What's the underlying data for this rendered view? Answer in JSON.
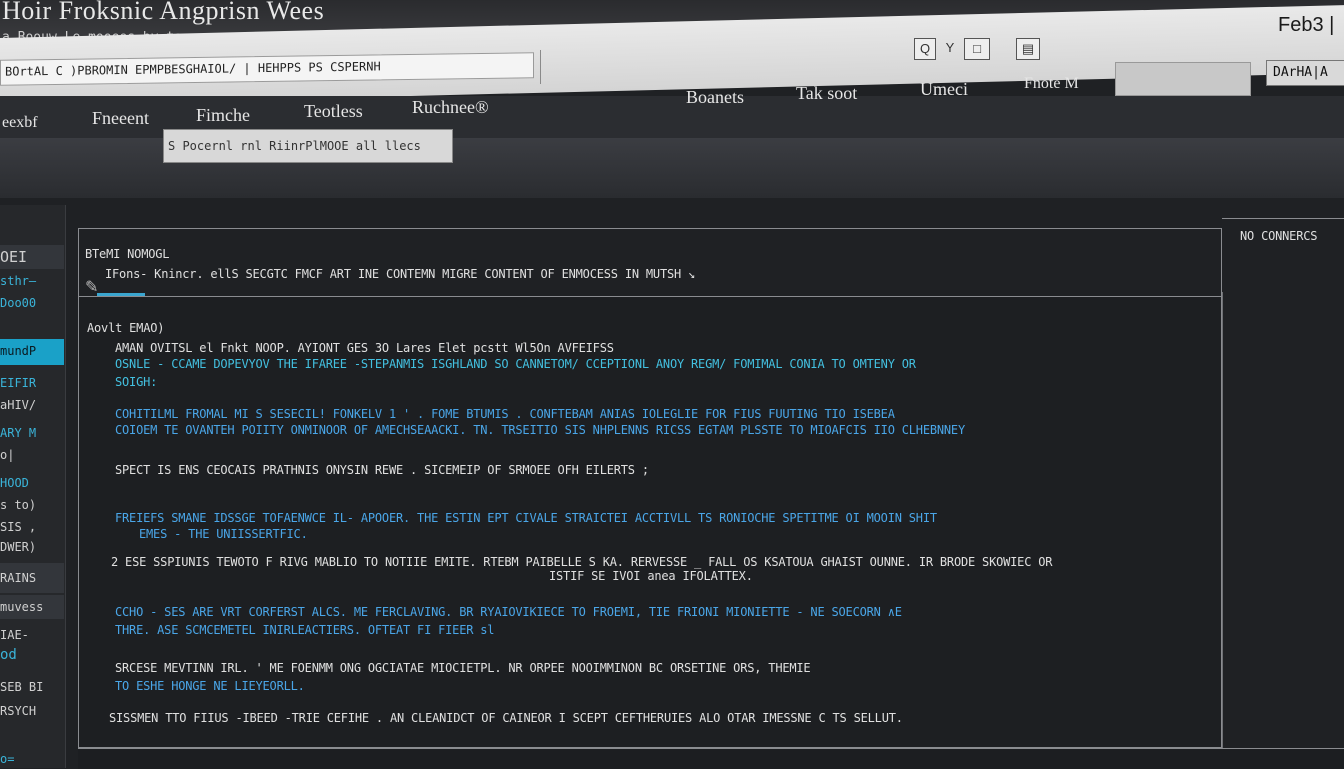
{
  "window": {
    "title": "Hoir Froksnic Angprisn Wees",
    "subtitle": "a Boouw Le mooees by to",
    "brand": "Feb3 |"
  },
  "toolbar": {
    "address": "BOrtAL C )PBROMIN EPMPBESGHAIOL/ | HEHPPS PS CSPERNH",
    "icon_search": "Q",
    "icon_filter": "Y",
    "icon_box": "□",
    "icon_grid": "▤"
  },
  "nav": {
    "items": [
      "eexbf",
      "Fneeent",
      "Fimche",
      "Teotless",
      "Ruchnee®",
      "Boanets",
      "Tak soot",
      "Umeci",
      "Fnote M"
    ],
    "right_button": "DArHA|A"
  },
  "tooltip": "S Pocernl rnl RiinrPlMOOE all llecs",
  "sidebar": {
    "items": [
      {
        "label": "OEI",
        "style": "hi"
      },
      {
        "label": "sthr—",
        "style": "cyan"
      },
      {
        "label": "Doo00",
        "style": "cyan"
      },
      {
        "label": "mundP",
        "style": "active"
      },
      {
        "label": "EIFIR",
        "style": "cyan"
      },
      {
        "label": "aHIV/",
        "style": ""
      },
      {
        "label": "ARY M",
        "style": "cyan"
      },
      {
        "label": "o|",
        "style": ""
      },
      {
        "label": "HOOD",
        "style": "cyan"
      },
      {
        "label": "s to)",
        "style": ""
      },
      {
        "label": "SIS ,",
        "style": ""
      },
      {
        "label": "DWER)",
        "style": ""
      },
      {
        "label": "RAINS",
        "style": "hi"
      },
      {
        "label": "muvess",
        "style": "hi"
      },
      {
        "label": "IAE-",
        "style": ""
      },
      {
        "label": "od",
        "style": "cyan"
      },
      {
        "label": "SEB BI",
        "style": ""
      },
      {
        "label": "RSYCH",
        "style": ""
      },
      {
        "label": "o=",
        "style": "cyan"
      }
    ]
  },
  "top_panel": {
    "heading": "BTeMI NOMOGL",
    "line": "IFons- Knincr. ellS SECGTC  FMCF ART INE CONTEMN MIGRE CONTENT OF ENMOCESS IN MUTSH ↘"
  },
  "right_panel": {
    "label": "NO CONNERCS"
  },
  "main": {
    "heading": "Aovlt EMAO)",
    "paragraphs": [
      {
        "text": "AMAN OVITSL el Fnkt NOOP. AYIONT GES 3O Lares Elet pcstt Wl5On AVFEIFSS",
        "style": ""
      },
      {
        "text": "OSNLE - CCAME DOPEVYOV  THE IFAREE -STEPANMIS ISGHLAND SO CANNETOM/ CCEPTIONL  ANOY REGM/ FOMIMAL CONIA TO OMTENY OR",
        "style": "cyan"
      },
      {
        "text": "SOIGH:",
        "style": "cyan"
      },
      {
        "text": "COHITILML FROMAL MI S SESECIL! FONKELV 1 ' . FOME BTUMIS . CONFTEBAM ANIAS IOLEGLIE FOR FIUS FUUTING TIO ISEBEA",
        "style": "blue"
      },
      {
        "text": "COIOEM TE OVANTEH POIITY ONMINOOR OF AMECHSEAACKI. TN. TRSEITIO SIS NHPLENNS RICSS EGTAM PLSSTE TO MIOAFCIS IIO CLHEBNNEY",
        "style": "blue"
      },
      {
        "text": "SPECT IS ENS CEOCAIS PRATHNIS ONYSIN REWE . SICEMEIP OF SRMOEE OFH EILERTS ;",
        "style": ""
      },
      {
        "text": "FREIEFS SMANE IDSSGE TOFAENWCE IL- APOOER. THE ESTIN EPT CIVALE STRAICTEI ACCTIVLL TS RONIOCHE SPETITME OI MOOIN SHIT",
        "style": "blue"
      },
      {
        "text": "EMES - THE UNIISSERTFIC.",
        "style": "blue"
      },
      {
        "text": "2 ESE SSPIUNIS TEWOTO F RIVG MABLIO TO NOTIIE EMITE. RTEBM PAIBELLE S KA. RERVESSE _ FALL OS KSATOUA GHAIST OUNNE. IR BRODE SKOWIEC OR",
        "style": ""
      },
      {
        "text": "ISTIF SE IVOI anea IFOLATTEX.",
        "style": ""
      },
      {
        "text": "CCHO - SES ARE VRT CORFERST ALCS. ME FERCLAVING. BR RYAIOVIKIECE TO FROEMI, TIE FRIONI MIONIETTE - NE SOECORN ∧E",
        "style": "blue"
      },
      {
        "text": "THRE. ASE SCMCEMETEL INIRLEACTIERS. OFTEAT FI FIEER sl",
        "style": "blue"
      },
      {
        "text": "SRCESE MEVTINN IRL. ' ME FOENMM ONG OGCIATAE MIOCIETPL. NR ORPEE NOOIMMINON BC ORSETINE ORS, THEMIE",
        "style": ""
      },
      {
        "text": "TO ESHE HONGE NE LIEYEORLL.",
        "style": "blue"
      },
      {
        "text": "SISSMEN TTO FIIUS -IBEED -TRIE CEFIHE . AN CLEANIDCT OF CAINEOR I SCEPT CEFTHERUIES ALO OTAR IMESSNE C TS SELLUT.",
        "style": ""
      }
    ]
  },
  "colors": {
    "accent_cyan": "#1aa1c8",
    "text_blue": "#4aa6e8",
    "background": "#1f2124"
  }
}
